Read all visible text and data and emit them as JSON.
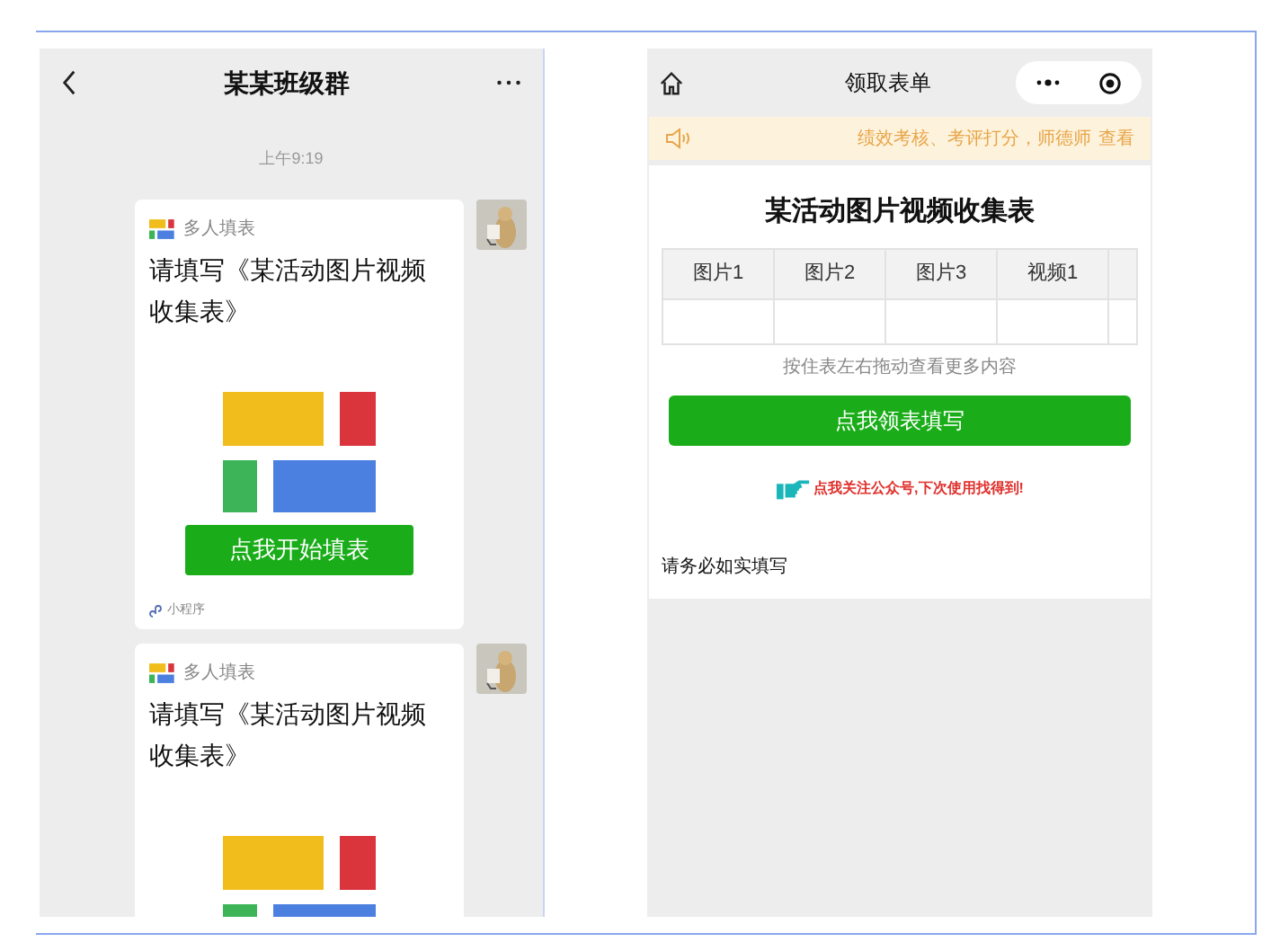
{
  "chat": {
    "title": "某某班级群",
    "timestamp": "上午9:19",
    "messages": [
      {
        "app_name": "多人填表",
        "title": "请填写《某活动图片视频收集表》",
        "button": "点我开始填表",
        "footer": "小程序"
      },
      {
        "app_name": "多人填表",
        "title": "请填写《某活动图片视频收集表》"
      }
    ]
  },
  "form_page": {
    "title": "领取表单",
    "notice": "绩效考核、考评打分，师德师",
    "notice_link": "查看",
    "heading": "某活动图片视频收集表",
    "table": {
      "columns": [
        "图片1",
        "图片2",
        "图片3",
        "视频1"
      ]
    },
    "hint": "按住表左右拖动查看更多内容",
    "button": "点我领表填写",
    "follow_link": "点我关注公众号,下次使用找得到!",
    "note": "请务必如实填写"
  }
}
